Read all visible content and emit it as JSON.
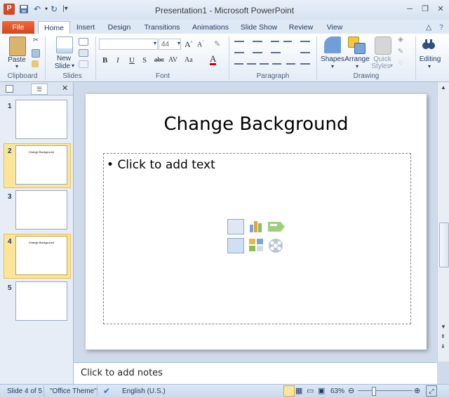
{
  "window": {
    "title": "Presentation1  -  Microsoft PowerPoint"
  },
  "tabs": [
    "File",
    "Home",
    "Insert",
    "Design",
    "Transitions",
    "Animations",
    "Slide Show",
    "Review",
    "View"
  ],
  "ribbon": {
    "clipboard": {
      "paste": "Paste",
      "group": "Clipboard"
    },
    "slides": {
      "new_slide_1": "New",
      "new_slide_2": "Slide",
      "group": "Slides"
    },
    "font": {
      "size": "44",
      "group": "Font"
    },
    "paragraph": {
      "group": "Paragraph"
    },
    "drawing": {
      "shapes": "Shapes",
      "arrange": "Arrange",
      "quick_1": "Quick",
      "quick_2": "Styles",
      "group": "Drawing"
    },
    "editing": {
      "label": "Editing"
    }
  },
  "slides_panel": {
    "thumbs": [
      {
        "num": "1",
        "title": ""
      },
      {
        "num": "2",
        "title": "Change Background"
      },
      {
        "num": "3",
        "title": ""
      },
      {
        "num": "4",
        "title": "Change Background"
      },
      {
        "num": "5",
        "title": ""
      }
    ],
    "selected_index": 4
  },
  "slide": {
    "title": "Change Background",
    "body_placeholder": "Click to add text"
  },
  "notes": {
    "placeholder": "Click to add notes"
  },
  "status": {
    "slide": "Slide 4 of 5",
    "theme": "\"Office Theme\"",
    "language": "English (U.S.)",
    "zoom": "63%"
  },
  "colors": {
    "file_tab": "#d4461d",
    "selection": "#fbe59b",
    "accent": "#1e395b"
  }
}
